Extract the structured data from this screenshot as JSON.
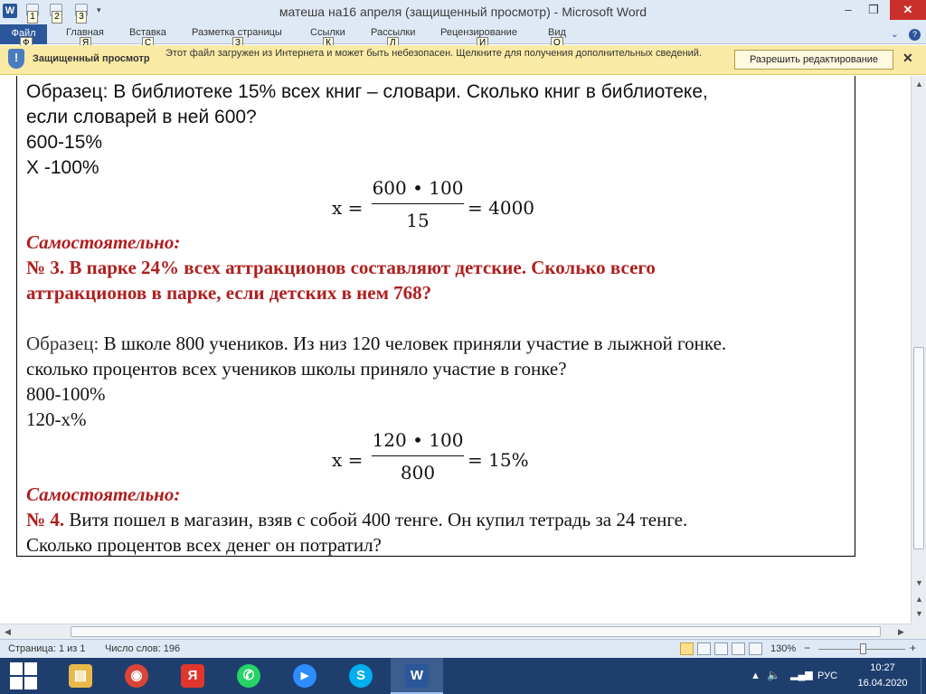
{
  "window": {
    "title": "матеша на16 апреля (защищенный просмотр)  -  Microsoft Word",
    "app_icon": "W",
    "controls": {
      "minimize": "–",
      "restore": "❐",
      "close": "✕"
    }
  },
  "qat": {
    "keytips": [
      "1",
      "2",
      "3"
    ]
  },
  "ribbon": {
    "tabs": [
      {
        "label": "Файл",
        "keytip": "Ф"
      },
      {
        "label": "Главная",
        "keytip": "Я"
      },
      {
        "label": "Вставка",
        "keytip": "С"
      },
      {
        "label": "Разметка страницы",
        "keytip": "З"
      },
      {
        "label": "Ссылки",
        "keytip": "К"
      },
      {
        "label": "Рассылки",
        "keytip": "Л"
      },
      {
        "label": "Рецензирование",
        "keytip": "И"
      },
      {
        "label": "Вид",
        "keytip": "О"
      }
    ],
    "help_glyph": "?"
  },
  "protected_view": {
    "title": "Защищенный просмотр",
    "message": "Этот файл загружен из Интернета и может быть небезопасен. Щелкните для получения дополнительных сведений.",
    "enable_button": "Разрешить редактирование",
    "close_glyph": "✕"
  },
  "document": {
    "sample1_line1": "Образец: В библиотеке 15% всех книг – словари. Сколько книг в библиотеке,",
    "sample1_line2": "если словарей в ней 600?",
    "sample1_prop1": "600-15%",
    "sample1_prop2": "Х   -100%",
    "formula1": {
      "lhs": "x =",
      "num": "600 • 100",
      "den": "15",
      "rhs": "= 4000"
    },
    "self1": "Самостоятельно:",
    "task3_num": "№ 3.",
    "task3_line1": "В парке 24% всех аттракционов  составляют детские. Сколько всего",
    "task3_line2": "аттракционов  в парке, если детских в нем 768?",
    "sample2_label": "Образец:",
    "sample2_line1": "В школе 800 учеников. Из низ 120 человек приняли участие в лыжной гонке.",
    "sample2_line2": "сколько процентов всех учеников школы приняло участие в гонке?",
    "sample2_prop1": "800-100%",
    "sample2_prop2": "120-х%",
    "formula2": {
      "lhs": "x =",
      "num": "120 • 100",
      "den": "800",
      "rhs": "= 15%"
    },
    "self2": "Самостоятельно:",
    "task4_num": "№ 4.",
    "task4_line1": "Витя пошел в магазин, взяв с собой 400 тенге. Он купил тетрадь за 24 тенге.",
    "task4_line2": "Сколько процентов всех денег он потратил?"
  },
  "statusbar": {
    "page": "Страница: 1 из 1",
    "words": "Число слов: 196",
    "zoom": "130%",
    "zoom_minus": "−",
    "zoom_plus": "+"
  },
  "taskbar": {
    "apps": [
      {
        "name": "file-explorer",
        "glyph": "▤",
        "color": "#e8b84a"
      },
      {
        "name": "chrome",
        "glyph": "◉",
        "color": "#db4437"
      },
      {
        "name": "yandex",
        "glyph": "Я",
        "color": "#e0362c"
      },
      {
        "name": "whatsapp",
        "glyph": "✆",
        "color": "#25d366"
      },
      {
        "name": "zoom",
        "glyph": "▶",
        "color": "#2d8cff"
      },
      {
        "name": "skype",
        "glyph": "S",
        "color": "#00aff0"
      },
      {
        "name": "word",
        "glyph": "W",
        "color": "#2b579a"
      }
    ],
    "lang": "РУС",
    "time": "10:27",
    "date": "16.04.2020"
  },
  "colors": {
    "accent": "#2b579a",
    "task_red": "#b01e1e",
    "protected_bar": "#fbeaa5"
  }
}
